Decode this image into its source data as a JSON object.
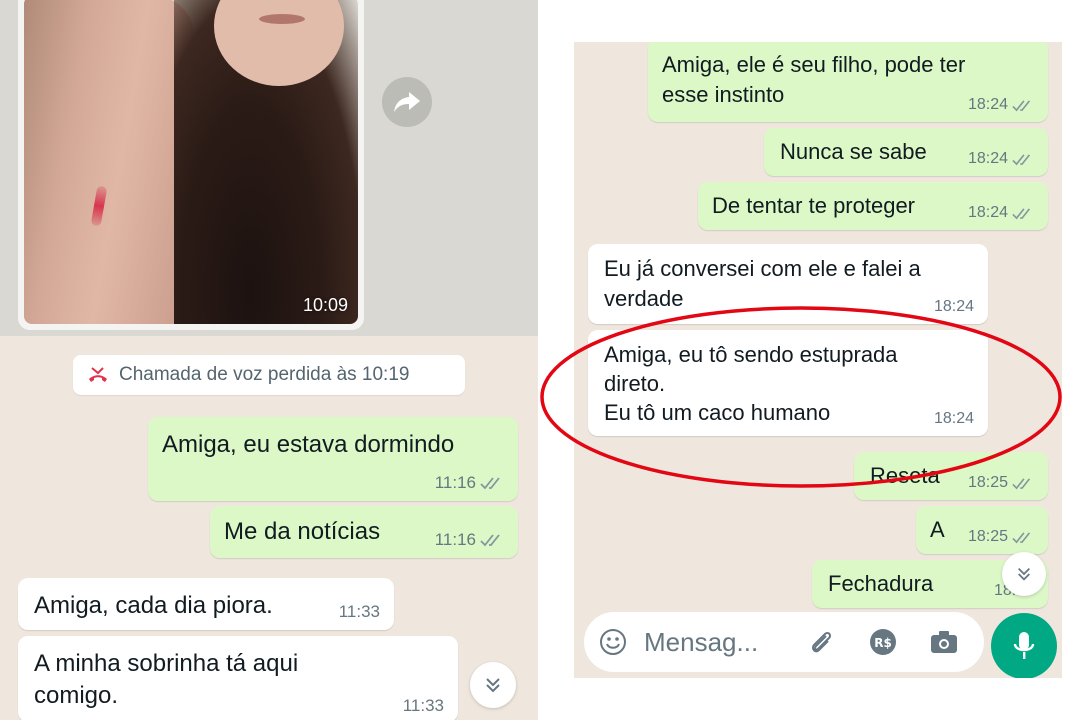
{
  "left": {
    "photo_time": "10:09",
    "missed_call": "Chamada de voz perdida às 10:19",
    "messages": [
      {
        "text": "Amiga, eu estava dormindo",
        "time": "11:16",
        "direction": "out"
      },
      {
        "text": "Me da notícias",
        "time": "11:16",
        "direction": "out"
      },
      {
        "text": "Amiga, cada dia piora.",
        "time": "11:33",
        "direction": "in"
      },
      {
        "text_line1": "A minha sobrinha tá aqui",
        "text_line2": "comigo.",
        "time": "11:33",
        "direction": "in"
      }
    ]
  },
  "right": {
    "messages": [
      {
        "text_line1": "Amiga, ele é seu filho, pode ter",
        "text_line2": "esse instinto",
        "time": "18:24",
        "direction": "out"
      },
      {
        "text": "Nunca se sabe",
        "time": "18:24",
        "direction": "out"
      },
      {
        "text": "De tentar te proteger",
        "time": "18:24",
        "direction": "out"
      },
      {
        "text_line1": "Eu já conversei com ele e falei a",
        "text_line2": "verdade",
        "time": "18:24",
        "direction": "in"
      },
      {
        "text_line1": "Amiga, eu tô sendo estuprada",
        "text_line2": "direto.",
        "text_line3": "Eu tô um caco humano",
        "time": "18:24",
        "direction": "in"
      },
      {
        "text": "Reseta",
        "time": "18:25",
        "direction": "out"
      },
      {
        "text": "A",
        "time": "18:25",
        "direction": "out"
      },
      {
        "text": "Fechadura",
        "time": "18:25",
        "direction": "out"
      }
    ],
    "input_placeholder": "Mensag..."
  },
  "colors": {
    "chat_bg": "#efe7de",
    "outgoing_bubble": "#dcf8c6",
    "incoming_bubble": "#ffffff",
    "meta_text": "#667781",
    "mic_button": "#00a884",
    "missed_call_icon": "#e2314b",
    "highlight_circle": "#e30613"
  },
  "icons": [
    "forward-icon",
    "missed-call-icon",
    "double-check-icon",
    "chevron-down-icon",
    "emoji-icon",
    "attach-icon",
    "payment-icon",
    "camera-icon",
    "mic-icon"
  ]
}
